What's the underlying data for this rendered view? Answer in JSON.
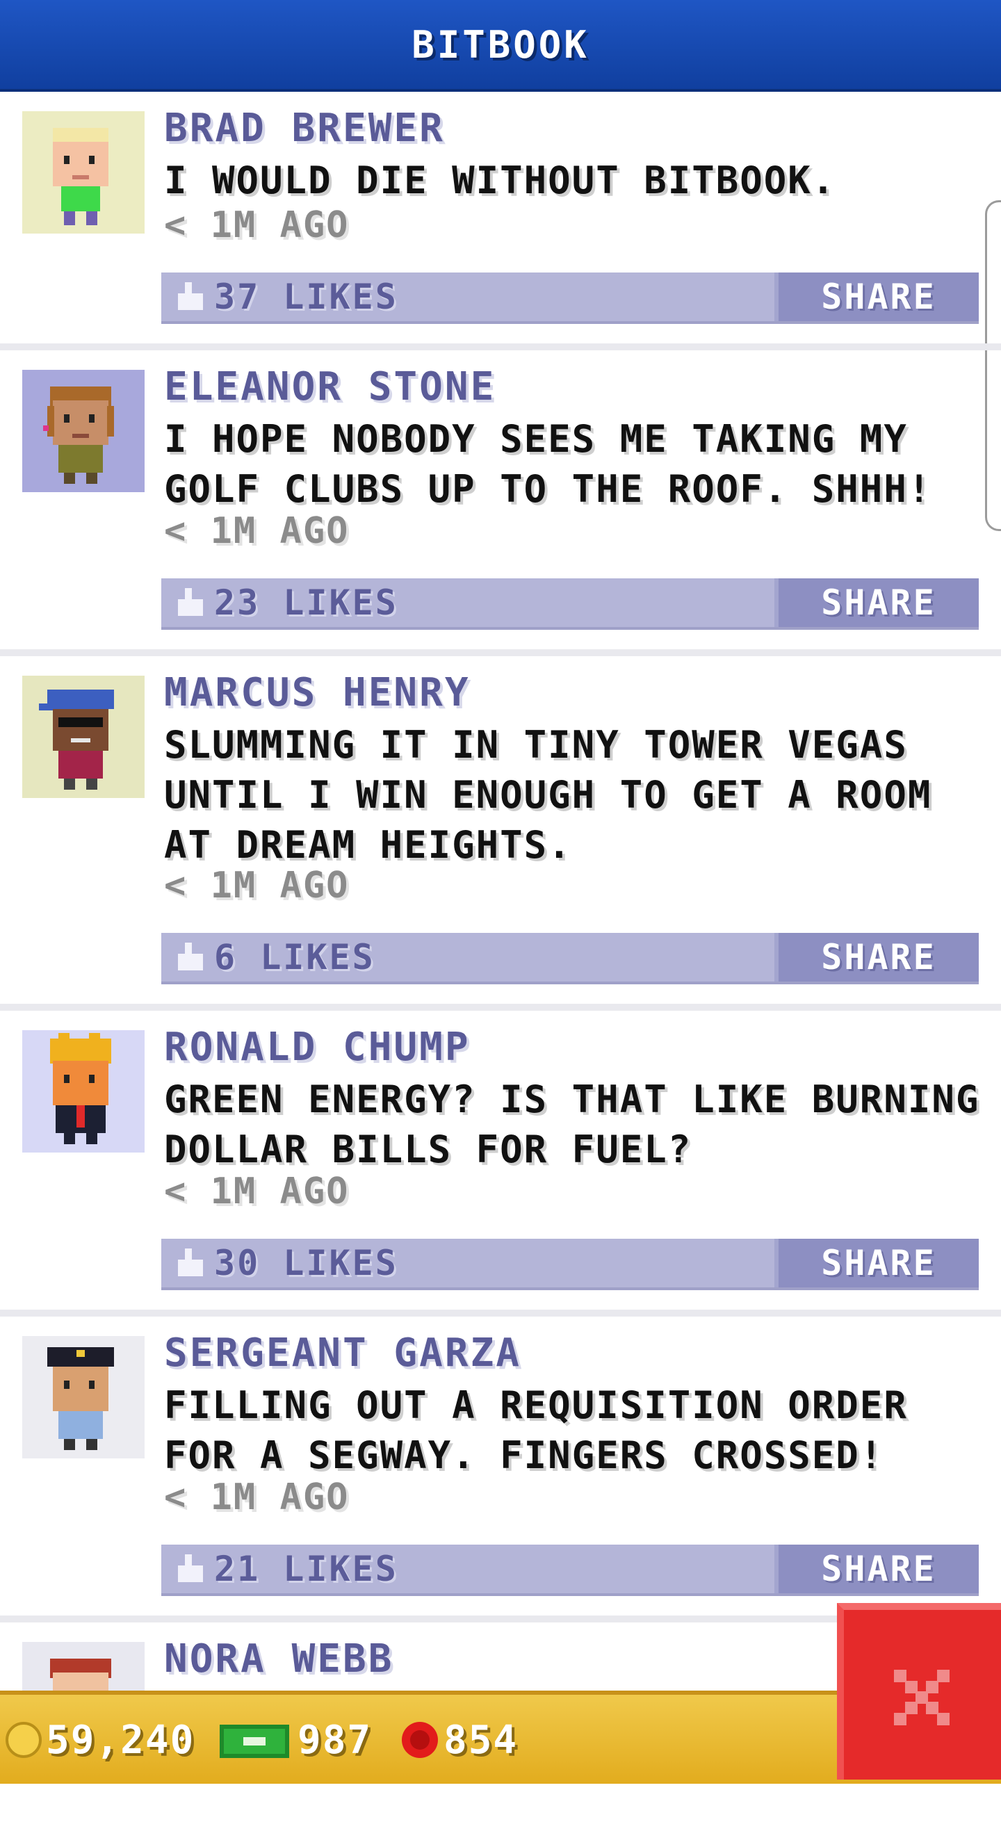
{
  "app": {
    "title": "BITBOOK"
  },
  "posts": [
    {
      "name": "BRAD BREWER",
      "message": "I WOULD DIE WITHOUT BITBOOK.",
      "time": "< 1M AGO",
      "likes": "37 LIKES",
      "share": "SHARE",
      "avatar_bg": "#ececc2"
    },
    {
      "name": "ELEANOR STONE",
      "message": "I HOPE NOBODY SEES ME TAKING MY GOLF CLUBS UP TO THE ROOF. SHHH!",
      "time": "< 1M AGO",
      "likes": "23 LIKES",
      "share": "SHARE",
      "avatar_bg": "#a8a8dc"
    },
    {
      "name": "MARCUS HENRY",
      "message": "SLUMMING IT IN TINY TOWER VEGAS UNTIL I WIN ENOUGH TO GET A ROOM AT DREAM HEIGHTS.",
      "time": "< 1M AGO",
      "likes": "6 LIKES",
      "share": "SHARE",
      "avatar_bg": "#e6e7bf"
    },
    {
      "name": "RONALD CHUMP",
      "message": "GREEN ENERGY? IS THAT LIKE BURNING DOLLAR BILLS FOR FUEL?",
      "time": "< 1M AGO",
      "likes": "30 LIKES",
      "share": "SHARE",
      "avatar_bg": "#d7d8f6"
    },
    {
      "name": "SERGEANT GARZA",
      "message": "FILLING OUT A REQUISITION ORDER FOR A SEGWAY. FINGERS CROSSED!",
      "time": "< 1M AGO",
      "likes": "21 LIKES",
      "share": "SHARE",
      "avatar_bg": "#ececf1"
    },
    {
      "name": "NORA WEBB",
      "message": "",
      "time": "",
      "likes": "",
      "share": "",
      "avatar_bg": "#e8e8f0"
    }
  ],
  "resources": {
    "coins": "59,240",
    "cash": "987",
    "bux": "854"
  },
  "icons": {
    "coin": "coin-icon",
    "cash": "cash-icon",
    "bux": "bux-icon",
    "close": "close-icon",
    "like": "thumbs-up-icon"
  },
  "colors": {
    "header": "#1b4fb8",
    "like_bar": "#b4b5d8",
    "share_button": "#8d8fc2",
    "name_text": "#5a5b98",
    "bottom_bar": "#e9b92e",
    "close_button": "#e52a2a"
  }
}
